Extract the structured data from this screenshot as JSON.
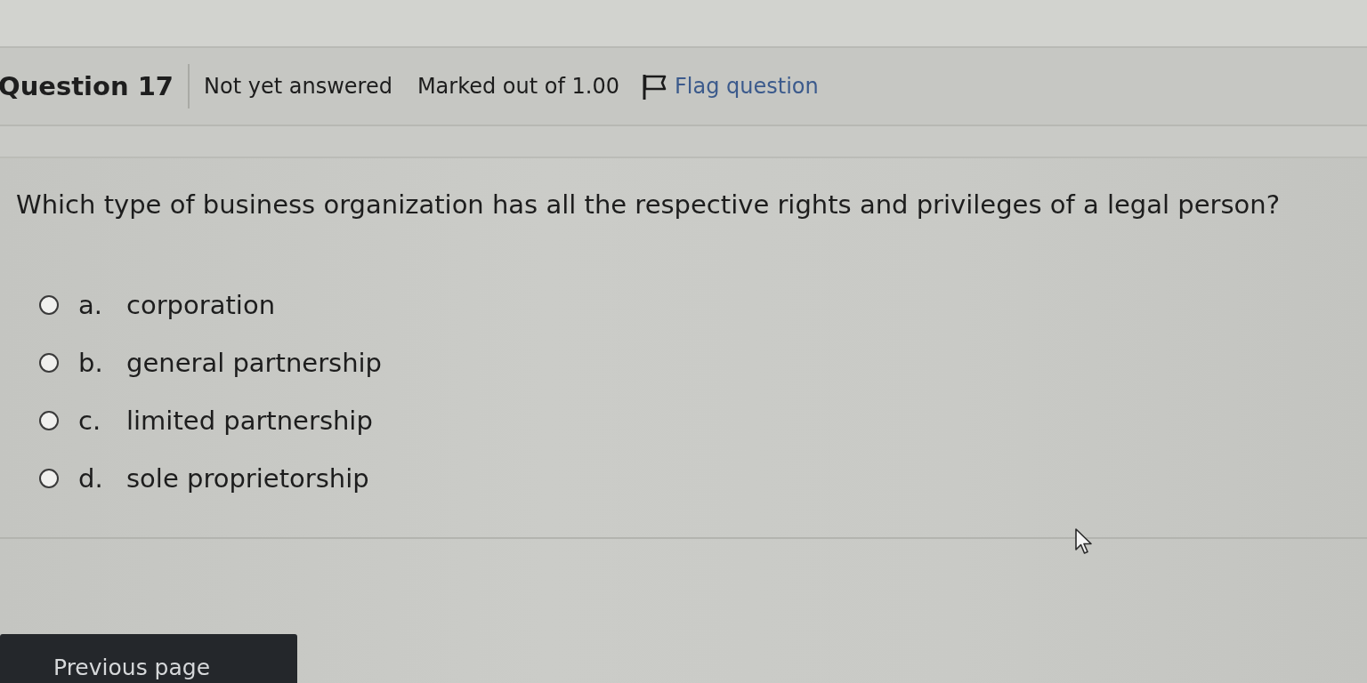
{
  "header": {
    "number_label": "Question 17",
    "status": "Not yet answered",
    "marks": "Marked out of 1.00",
    "flag": {
      "label": "Flag question",
      "flagged": false
    }
  },
  "prompt": "Which type of business organization has all the respective rights and privileges of a legal person?",
  "options": [
    {
      "letter": "a.",
      "text": "corporation",
      "selected": false
    },
    {
      "letter": "b.",
      "text": "general partnership",
      "selected": false
    },
    {
      "letter": "c.",
      "text": "limited partnership",
      "selected": false
    },
    {
      "letter": "d.",
      "text": "sole proprietorship",
      "selected": false
    }
  ],
  "navigation": {
    "previous_button": "Previous page"
  }
}
